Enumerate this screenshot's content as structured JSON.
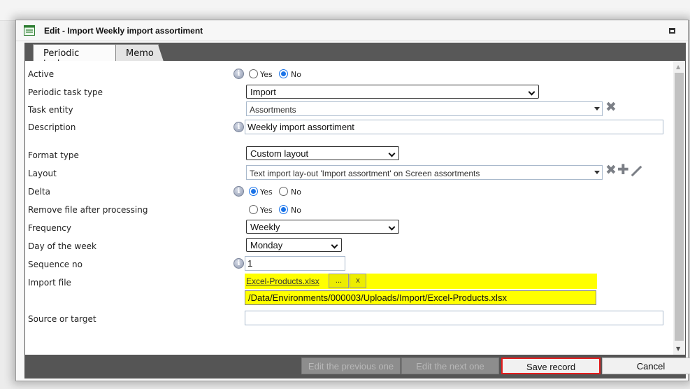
{
  "dialog": {
    "title": "Edit - Import Weekly import assortiment"
  },
  "tabs": [
    {
      "label": "Periodic tasks"
    },
    {
      "label": "Memo"
    }
  ],
  "fields": {
    "active": {
      "label": "Active",
      "yes": "Yes",
      "no": "No",
      "value": "No"
    },
    "task_type": {
      "label": "Periodic task type",
      "value": "Import"
    },
    "task_entity": {
      "label": "Task entity",
      "value": "Assortments"
    },
    "description": {
      "label": "Description",
      "value": "Weekly import assortiment"
    },
    "format_type": {
      "label": "Format type",
      "value": "Custom layout"
    },
    "layout": {
      "label": "Layout",
      "value": "Text import lay-out 'Import assortment' on Screen assortments"
    },
    "delta": {
      "label": "Delta",
      "yes": "Yes",
      "no": "No",
      "value": "Yes"
    },
    "remove_file": {
      "label": "Remove file after processing",
      "yes": "Yes",
      "no": "No",
      "value": "No"
    },
    "frequency": {
      "label": "Frequency",
      "value": "Weekly"
    },
    "day_of_week": {
      "label": "Day of the week",
      "value": "Monday"
    },
    "sequence_no": {
      "label": "Sequence no",
      "value": "1"
    },
    "import_file": {
      "label": "Import file",
      "file_name": "Excel-Products.xlsx",
      "browse_label": "...",
      "clear_label": "x",
      "path": "/Data/Environments/000003/Uploads/Import/Excel-Products.xlsx"
    },
    "source_target": {
      "label": "Source or target",
      "value": ""
    }
  },
  "footer": {
    "prev_label": "Edit the previous one",
    "next_label": "Edit the next one",
    "save_label": "Save record",
    "cancel_label": "Cancel"
  },
  "colors": {
    "highlight_yellow": "#ffff00",
    "save_border": "#e31d1d",
    "radio_accent": "#1a73e8"
  }
}
